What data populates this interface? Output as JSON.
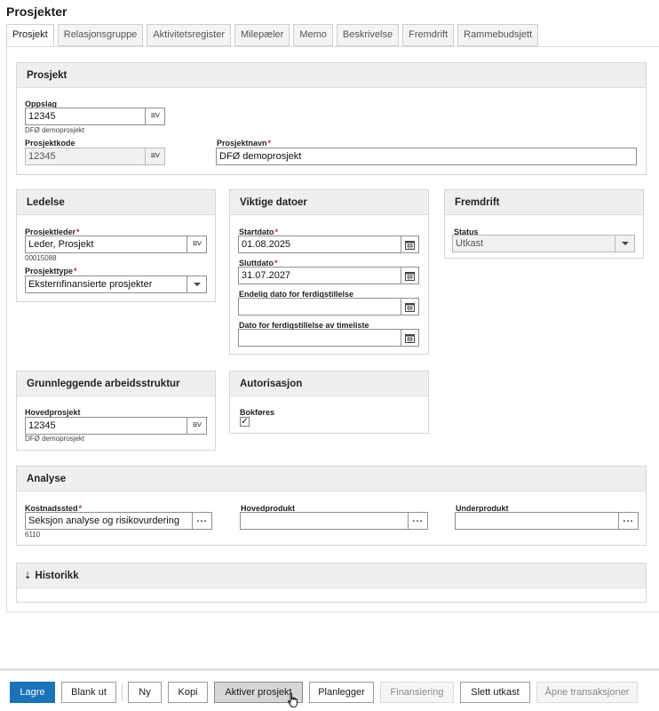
{
  "page": {
    "title": "Prosjekter"
  },
  "tabs": [
    {
      "label": "Prosjekt",
      "active": true
    },
    {
      "label": "Relasjonsgruppe"
    },
    {
      "label": "Aktivitetsregister"
    },
    {
      "label": "Milepæler"
    },
    {
      "label": "Memo"
    },
    {
      "label": "Beskrivelse"
    },
    {
      "label": "Fremdrift"
    },
    {
      "label": "Rammebudsjett"
    }
  ],
  "prosjekt": {
    "title": "Prosjekt",
    "oppslag": {
      "label": "Oppslag",
      "value": "12345",
      "sub": "DFØ demoprosjekt"
    },
    "prosjektkode": {
      "label": "Prosjektkode",
      "value": "12345"
    },
    "prosjektnavn": {
      "label": "Prosjektnavn",
      "value": "DFØ demoprosjekt"
    }
  },
  "ledelse": {
    "title": "Ledelse",
    "prosjektleder": {
      "label": "Prosjektleder",
      "value": "Leder, Prosjekt",
      "sub": "00015088"
    },
    "prosjekttype": {
      "label": "Prosjekttype",
      "value": "Eksternfinansierte prosjekter"
    }
  },
  "datoer": {
    "title": "Viktige datoer",
    "startdato": {
      "label": "Startdato",
      "value": "01.08.2025"
    },
    "sluttdato": {
      "label": "Sluttdato",
      "value": "31.07.2027"
    },
    "endelig": {
      "label": "Endelig dato for ferdigstillelse",
      "value": ""
    },
    "timeliste": {
      "label": "Dato for ferdigstillelse av timeliste",
      "value": ""
    }
  },
  "fremdrift": {
    "title": "Fremdrift",
    "status": {
      "label": "Status",
      "value": "Utkast"
    }
  },
  "arbeidsstruktur": {
    "title": "Grunnleggende arbeidsstruktur",
    "hovedprosjekt": {
      "label": "Hovedprosjekt",
      "value": "12345",
      "sub": "DFØ demoprosjekt"
    }
  },
  "autorisasjon": {
    "title": "Autorisasjon",
    "bokfores": {
      "label": "Bokføres",
      "checked": true,
      "mark": "✓"
    }
  },
  "analyse": {
    "title": "Analyse",
    "kostnadssted": {
      "label": "Kostnadssted",
      "value": "Seksjon analyse og risikovurdering",
      "sub": "6110"
    },
    "hovedprodukt": {
      "label": "Hovedprodukt",
      "value": ""
    },
    "underprodukt": {
      "label": "Underprodukt",
      "value": ""
    }
  },
  "historikk": {
    "title": "Historikk",
    "icon": "double-chevron-down-icon"
  },
  "icons": {
    "lookup": "≡˅",
    "ellipsis": "...",
    "required": "*"
  },
  "buttons": {
    "lagre": "Lagre",
    "blank_ut": "Blank ut",
    "ny": "Ny",
    "kopi": "Kopi",
    "aktiver": "Aktiver prosjekt",
    "planlegger": "Planlegger",
    "finansiering": "Finansiering",
    "slett": "Slett utkast",
    "apne": "Åpne transaksjoner"
  },
  "colors": {
    "primary": "#1a73b9",
    "required": "#c62828",
    "panel_header": "#efefef"
  }
}
